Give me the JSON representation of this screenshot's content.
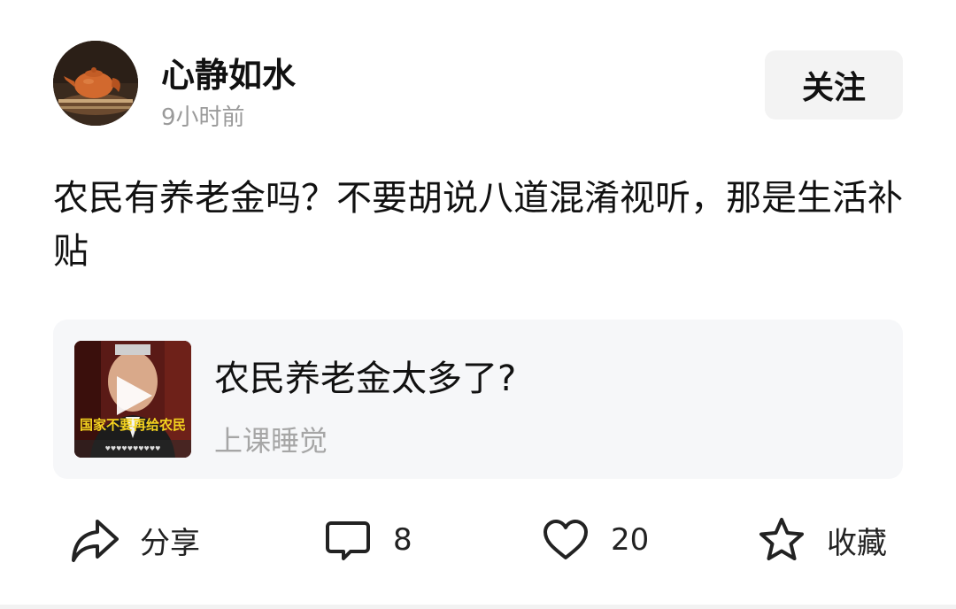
{
  "author": {
    "name": "心静如水",
    "time": "9小时前",
    "follow_label": "关注"
  },
  "post": {
    "text": "农民有养老金吗？不要胡说八道混淆视听，那是生活补贴"
  },
  "shared_video": {
    "title": "农民养老金太多了?",
    "author": "上课睡觉",
    "thumbnail_caption": "国家不要再给农民",
    "play_icon": "play-icon"
  },
  "actions": {
    "share_label": "分享",
    "comment_count": "8",
    "like_count": "20",
    "favorite_label": "收藏"
  }
}
